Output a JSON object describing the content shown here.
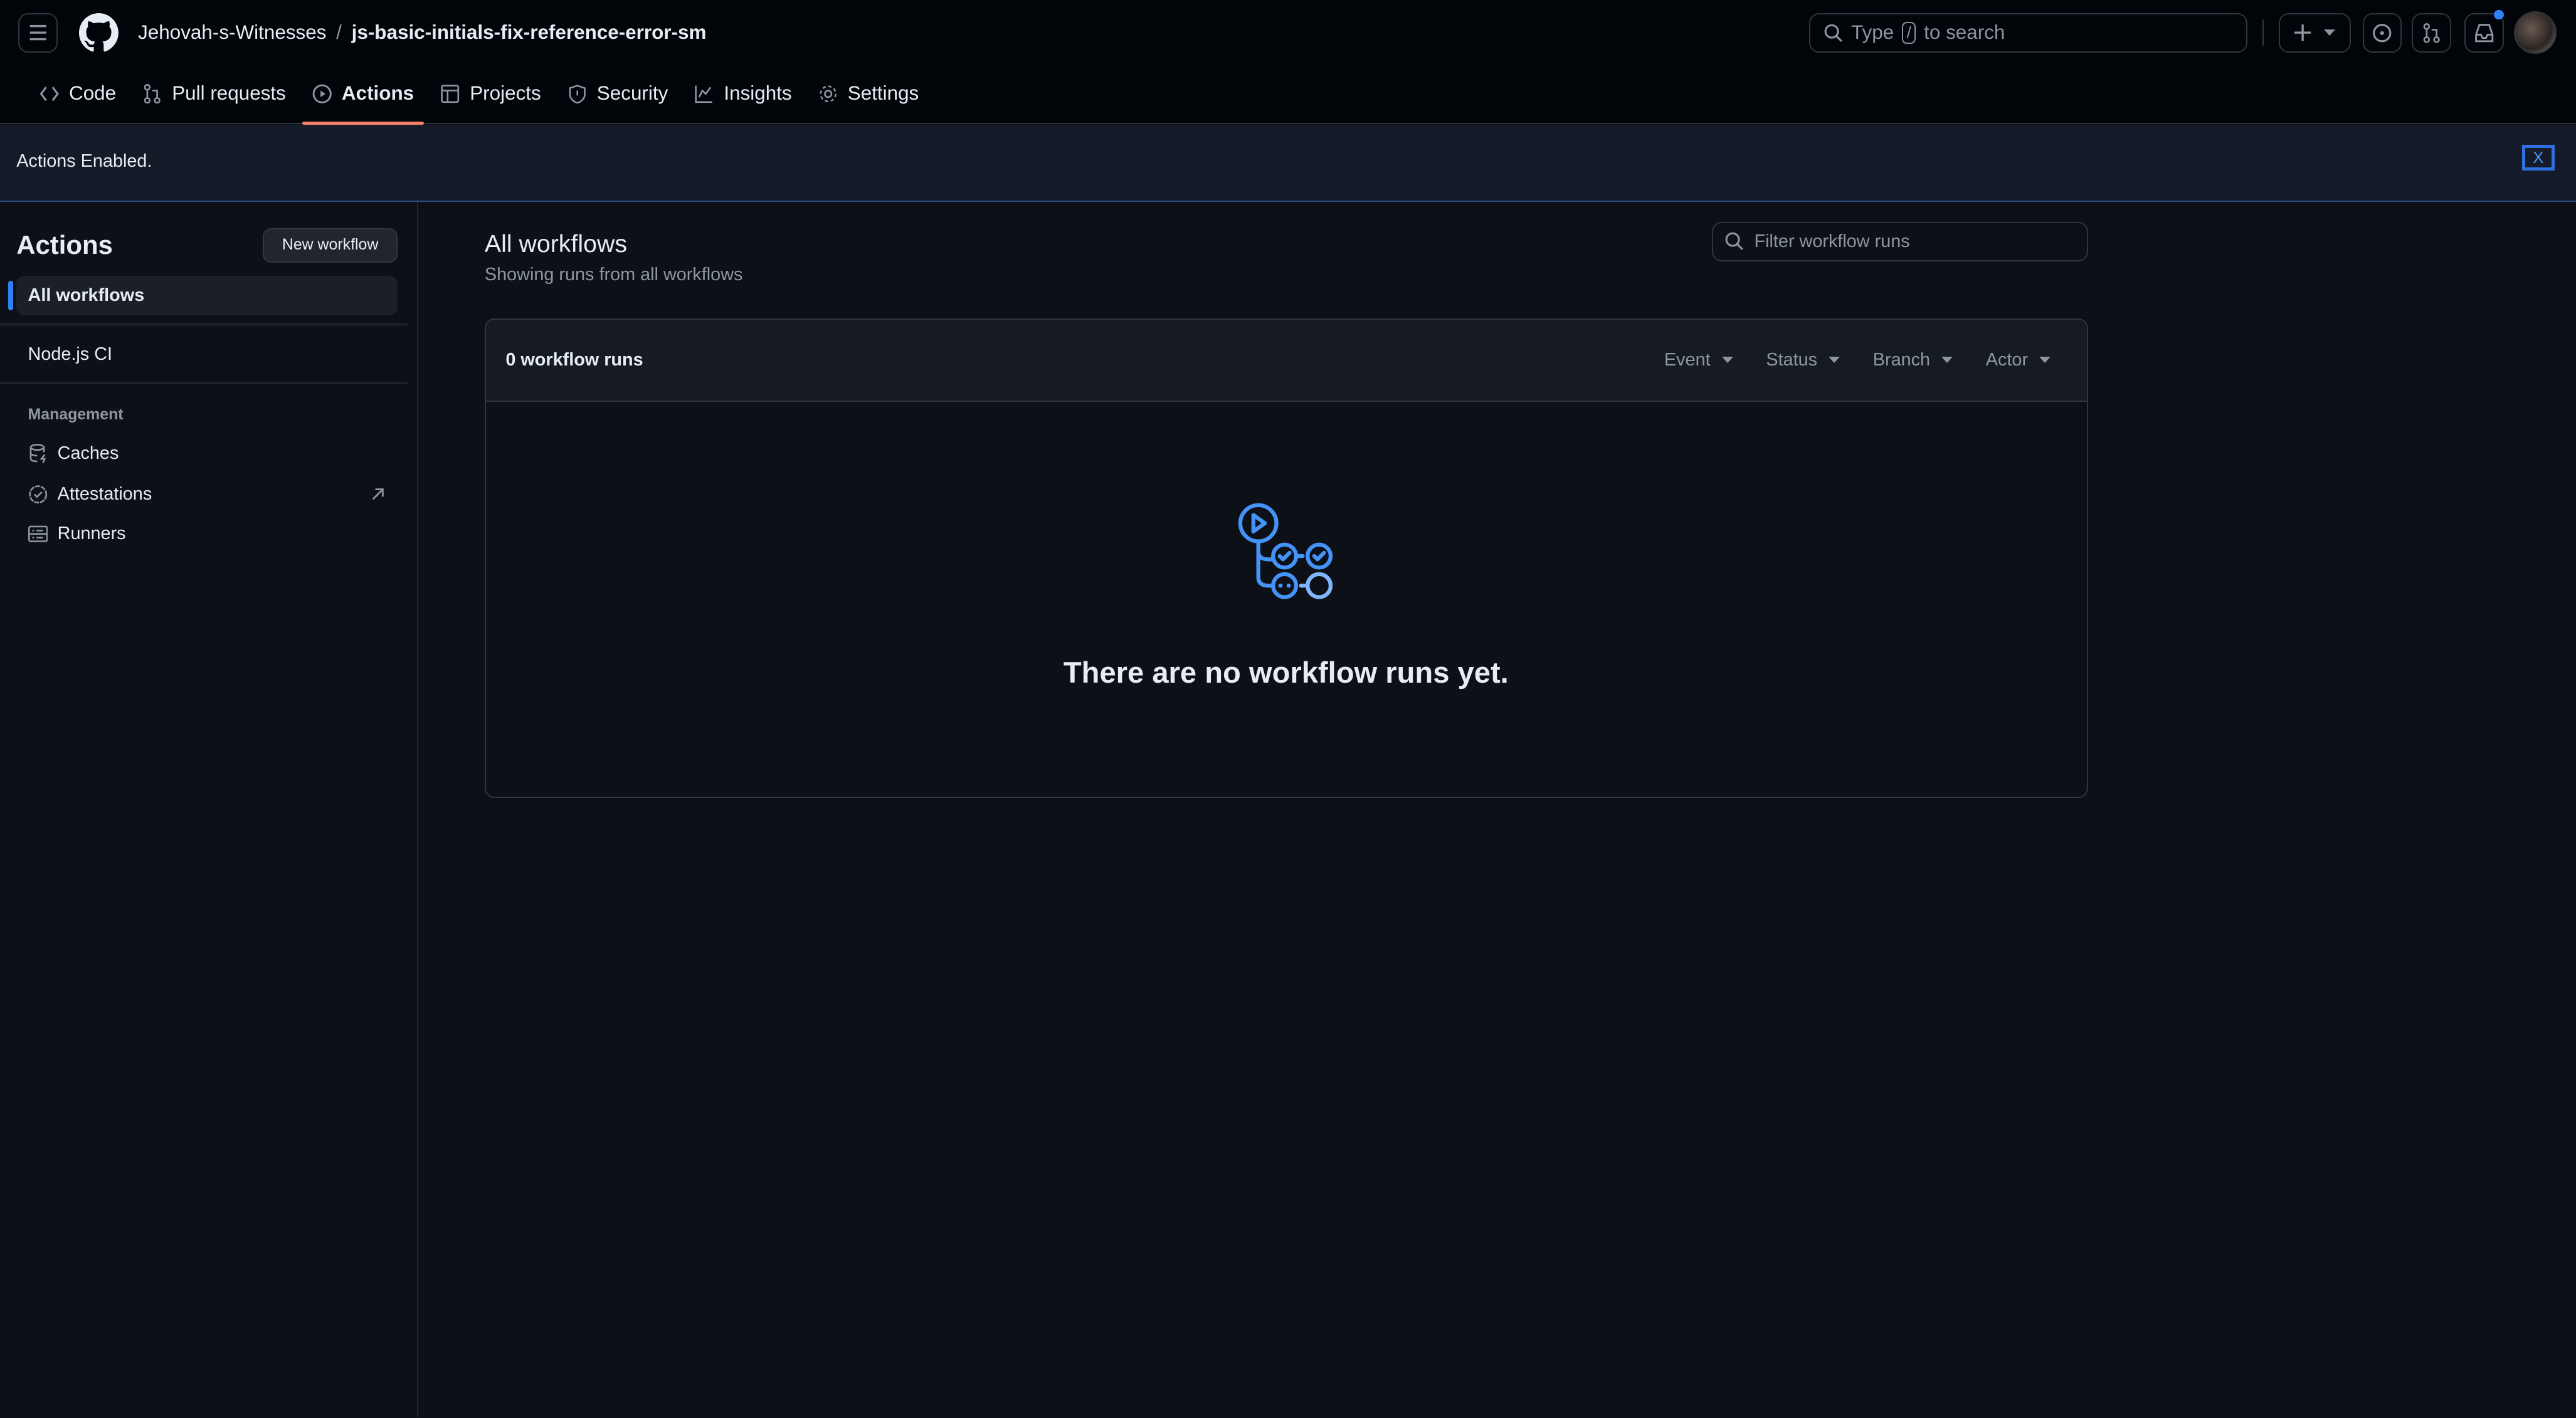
{
  "header": {
    "owner": "Jehovah-s-Witnesses",
    "separator": "/",
    "repo": "js-basic-initials-fix-reference-error-sm",
    "search": {
      "prefix": "Type",
      "key": "/",
      "suffix": "to search"
    },
    "notification_dot_color": "#2f81f7"
  },
  "repo_nav": [
    {
      "label": "Code",
      "icon": "code-icon"
    },
    {
      "label": "Pull requests",
      "icon": "git-pull-request-icon"
    },
    {
      "label": "Actions",
      "icon": "play-icon",
      "active": true
    },
    {
      "label": "Projects",
      "icon": "table-icon"
    },
    {
      "label": "Security",
      "icon": "shield-icon"
    },
    {
      "label": "Insights",
      "icon": "graph-icon"
    },
    {
      "label": "Settings",
      "icon": "gear-icon"
    }
  ],
  "banner": {
    "message": "Actions Enabled.",
    "close": "X"
  },
  "sidebar": {
    "title": "Actions",
    "new_workflow": "New workflow",
    "all_workflows": "All workflows",
    "workflows": [
      "Node.js CI"
    ],
    "management_heading": "Management",
    "management": [
      {
        "label": "Caches",
        "icon": "database-icon"
      },
      {
        "label": "Attestations",
        "icon": "verified-icon"
      },
      {
        "label": "Runners",
        "icon": "server-icon"
      }
    ]
  },
  "main": {
    "title": "All workflows",
    "subtitle": "Showing runs from all workflows",
    "filter_placeholder": "Filter workflow runs",
    "runs_count": "0 workflow runs",
    "filters": [
      "Event",
      "Status",
      "Branch",
      "Actor"
    ],
    "empty_message": "There are no workflow runs yet.",
    "accent": "#4493f8"
  }
}
